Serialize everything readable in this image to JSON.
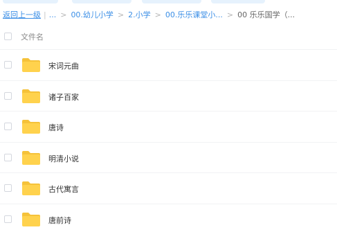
{
  "breadcrumb": {
    "back_label": "返回上一级",
    "ellipsis": "...",
    "crumbs": [
      "00.幼儿小学",
      "2.小学",
      "00.乐乐课堂小..."
    ],
    "current": "00 乐乐国学（...",
    "separator": ">",
    "pipe": "|"
  },
  "header": {
    "column_label": "文件名"
  },
  "files": [
    {
      "name": "宋词元曲",
      "icon": "folder-icon"
    },
    {
      "name": "诸子百家",
      "icon": "folder-icon"
    },
    {
      "name": "唐诗",
      "icon": "folder-icon"
    },
    {
      "name": "明清小说",
      "icon": "folder-icon"
    },
    {
      "name": "古代寓言",
      "icon": "folder-icon"
    },
    {
      "name": "唐前诗",
      "icon": "folder-icon"
    }
  ],
  "colors": {
    "link": "#3a8ee6",
    "folder": "#ffd24d",
    "folder_tab": "#f5c23a"
  }
}
